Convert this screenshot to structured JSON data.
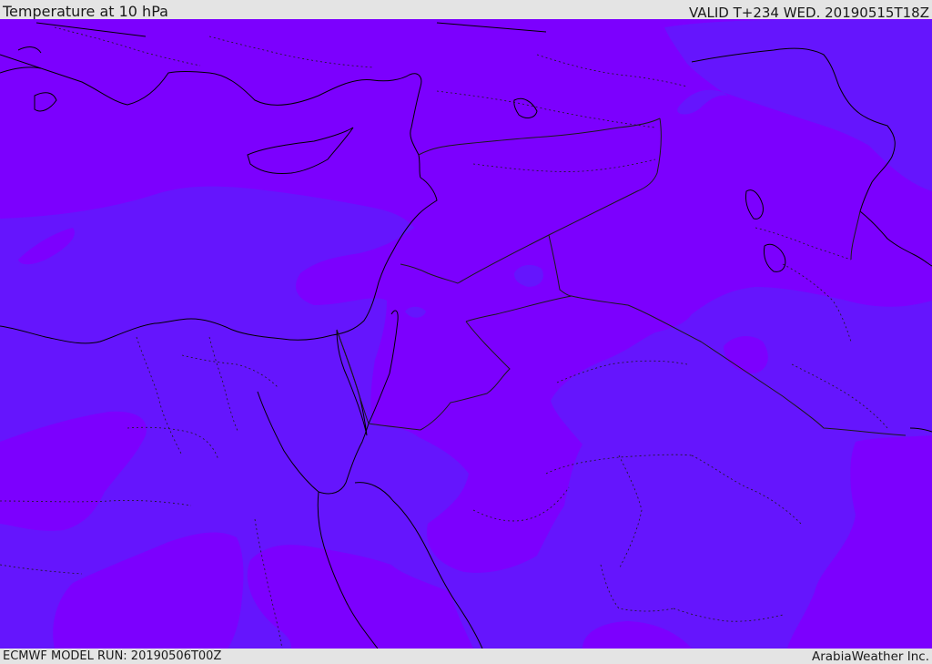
{
  "header": {
    "title": "Temperature at 10 hPa",
    "valid": "VALID T+234 WED. 20190515T18Z"
  },
  "footer": {
    "model_run": "ECMWF MODEL RUN: 20190506T00Z",
    "credit": "ArabiaWeather Inc."
  },
  "map": {
    "field": "temperature",
    "level": "10 hPa",
    "colors": {
      "band_warm": "#7c00fe",
      "band_cool": "#6515fd",
      "coastline": "#000000",
      "borders": "#1a1a1a"
    }
  }
}
